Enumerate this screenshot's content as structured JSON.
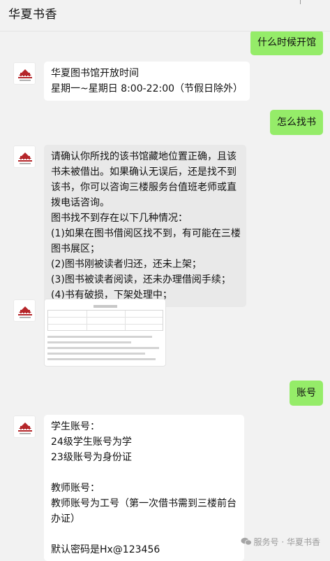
{
  "header": {
    "title": "华夏书香"
  },
  "messages": {
    "q1": "什么时候开馆",
    "a1": [
      "华夏图书馆开放时间",
      "星期一~星期日 8:00-22:00（节假日除外）"
    ],
    "q2": "怎么找书",
    "a2": [
      "请确认你所找的该书馆藏地位置正确，且该",
      "书未被借出。如果确认无误后，还是找不到",
      "该书，你可以咨询三楼服务台值班老师或直",
      "拨电话咨询。",
      "图书找不到存在以下几种情况：",
      "(1)如果在图书借阅区找不到，有可能在三楼",
      "图书展区；",
      "(2)图书刚被读者归还，还未上架；",
      "(3)图书被读者阅读，还未办理借阅手续；",
      "(4)书有破损，下架处理中；"
    ],
    "q3": "账号",
    "a3": {
      "student_title": "学生账号：",
      "student_24": "24级学生账号为学",
      "student_23": "23级账号为身份证",
      "teacher_title": "教师账号：",
      "teacher_line1": "教师账号为工号（第一次借书需到三楼前台",
      "teacher_line2": "办证）",
      "password": "默认密码是Hx@123456"
    }
  },
  "watermark": {
    "text": "服务号 · 华夏书香"
  },
  "colors": {
    "outgoing": "#95ec69",
    "incoming": "#ffffff",
    "background": "#f2f2f2",
    "logo_red": "#b5262a"
  }
}
